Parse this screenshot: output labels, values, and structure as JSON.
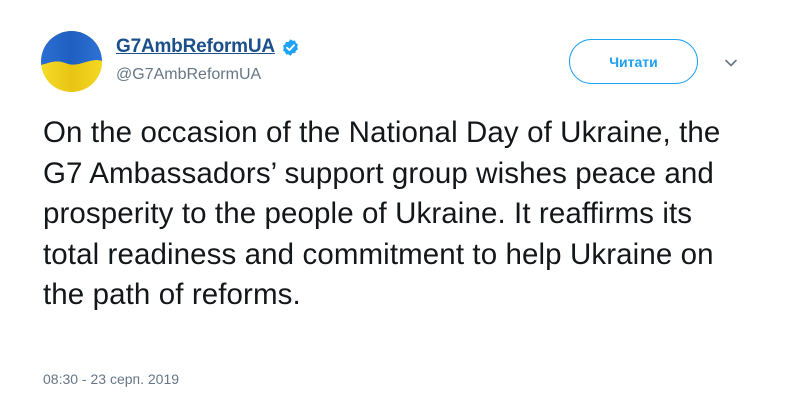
{
  "tweet": {
    "display_name": "G7AmbReformUA",
    "handle": "@G7AmbReformUA",
    "verified": true,
    "follow_label": "Читати",
    "text": "On the occasion of the National Day of Ukraine, the G7 Ambassadors’ support group wishes peace and prosperity to the people of Ukraine. It reaffirms its total readiness and commitment to help Ukraine on the path of reforms.",
    "timestamp": "08:30 - 23 серп. 2019"
  },
  "icons": {
    "avatar": "ukraine-flag-avatar",
    "verified": "verified-badge-icon",
    "more": "chevron-down-icon"
  },
  "colors": {
    "accent": "#1da1f2",
    "name": "#1b4f8a",
    "muted": "#657786",
    "text": "#14171a",
    "flag_blue": "#1f5fbf",
    "flag_yellow": "#f2d31b"
  }
}
